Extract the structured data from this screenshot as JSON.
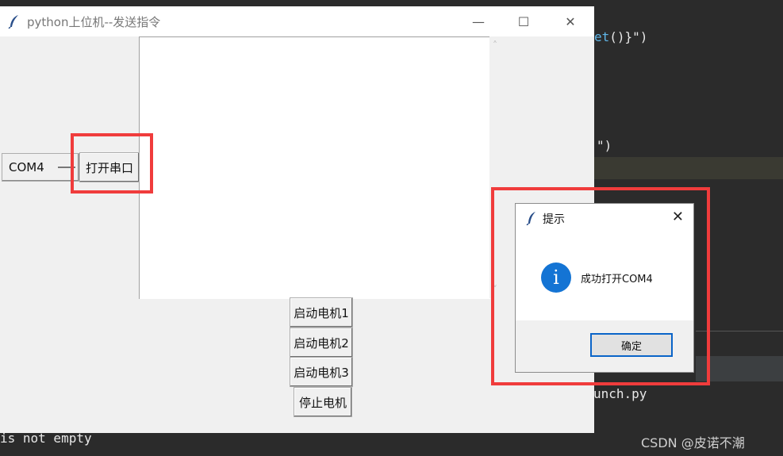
{
  "editor": {
    "line1": "et()}\")",
    "line2": "\")",
    "line3": "unch.py",
    "line4": "is not empty",
    "watermark": "CSDN @皮诺不潮"
  },
  "window": {
    "title": "python上位机--发送指令",
    "minimize": "—",
    "maximize": "☐",
    "close": "✕"
  },
  "controls": {
    "port_value": "COM4",
    "open_port_label": "打开串口",
    "motor1_label": "启动电机1",
    "motor2_label": "启动电机2",
    "motor3_label": "启动电机3",
    "stop_label": "停止电机"
  },
  "dialog": {
    "title": "提示",
    "close": "✕",
    "icon_glyph": "i",
    "message": "成功打开COM4",
    "ok_label": "确定"
  },
  "colors": {
    "annotation_red": "#f03c3c",
    "info_blue": "#1474d4"
  }
}
